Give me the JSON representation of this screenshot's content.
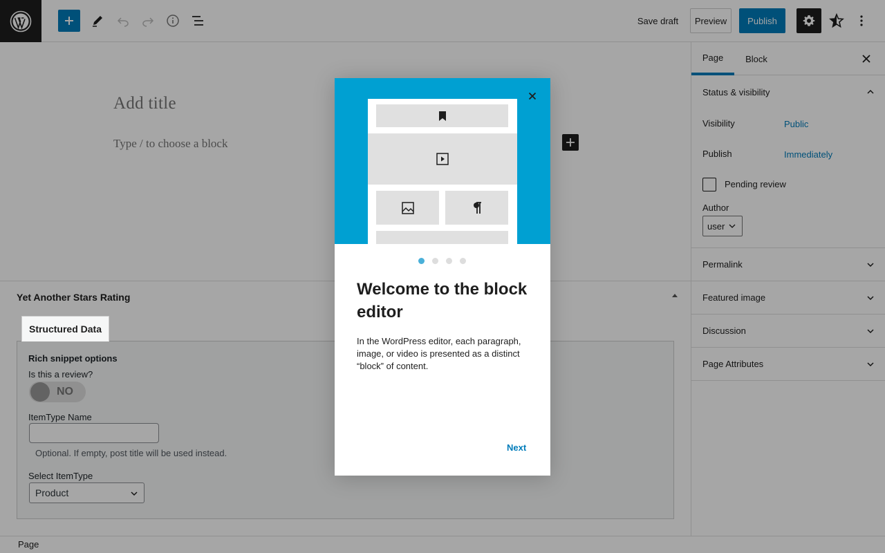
{
  "toolbar": {
    "save_draft": "Save draft",
    "preview": "Preview",
    "publish": "Publish",
    "icons": [
      "wordpress-logo-icon",
      "plus-icon",
      "pencil-icon",
      "undo-icon",
      "redo-icon",
      "info-icon",
      "list-view-icon",
      "gear-icon",
      "star-plugin-icon",
      "more-vertical-icon"
    ]
  },
  "editor": {
    "title_placeholder": "Add title",
    "block_hint": "Type / to choose a block"
  },
  "metabox": {
    "title": "Yet Another Stars Rating",
    "tab": "Structured Data",
    "rich_snippet_title": "Rich snippet options",
    "is_review_label": "Is this a review?",
    "toggle_state": "NO",
    "itemtype_name_label": "ItemType Name",
    "itemtype_name_value": "",
    "optional_hint": "Optional. If empty, post title will be used instead.",
    "select_itemtype_label": "Select ItemType",
    "select_itemtype_value": "Product"
  },
  "sidebar": {
    "tabs": [
      "Page",
      "Block"
    ],
    "status": {
      "heading": "Status & visibility",
      "visibility_label": "Visibility",
      "visibility_value": "Public",
      "publish_label": "Publish",
      "publish_value": "Immediately",
      "pending_label": "Pending review",
      "author_label": "Author",
      "author_value": "user"
    },
    "sections": [
      "Permalink",
      "Featured image",
      "Discussion",
      "Page Attributes"
    ]
  },
  "footer": {
    "breadcrumb": "Page"
  },
  "modal": {
    "heading": "Welcome to the block editor",
    "body": "In the WordPress editor, each paragraph, image, or video is presented as a distinct “block” of content.",
    "next": "Next",
    "page_count": 4,
    "current_page": 1,
    "hero_color": "#00a0d2"
  },
  "colors": {
    "accent": "#007cba",
    "dark": "#1e1e1e"
  }
}
